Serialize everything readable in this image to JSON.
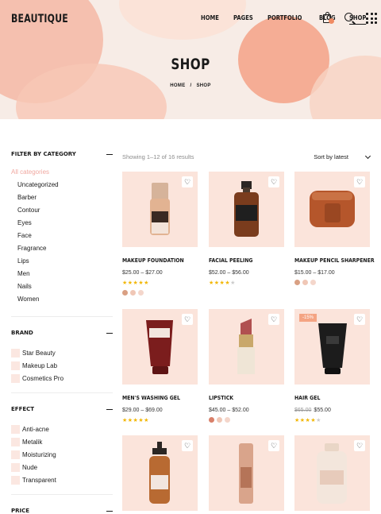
{
  "header": {
    "logo": "BEAUTIQUE",
    "nav": [
      {
        "label": "HOME",
        "active": false
      },
      {
        "label": "PAGES",
        "active": false
      },
      {
        "label": "PORTFOLIO",
        "active": false
      },
      {
        "label": "BLOG",
        "active": false
      },
      {
        "label": "SHOP",
        "active": true
      }
    ],
    "icons": [
      "cart-icon",
      "search-icon",
      "grid-menu-icon"
    ]
  },
  "hero": {
    "title": "SHOP",
    "breadcrumb": {
      "home": "HOME",
      "sep": "/",
      "current": "SHOP"
    }
  },
  "sidebar": {
    "category": {
      "title": "FILTER BY CATEGORY",
      "items": [
        "All categories",
        "Uncategorized",
        "Barber",
        "Contour",
        "Eyes",
        "Face",
        "Fragrance",
        "Lips",
        "Men",
        "Nails",
        "Women"
      ]
    },
    "brand": {
      "title": "BRAND",
      "items": [
        "Star Beauty",
        "Makeup Lab",
        "Cosmetics Pro"
      ]
    },
    "effect": {
      "title": "EFFECT",
      "items": [
        "Anti-acne",
        "Metalik",
        "Moisturizing",
        "Nude",
        "Transparent"
      ]
    },
    "price": {
      "title": "PRICE"
    }
  },
  "toolbar": {
    "result_count": "Showing 1–12 of 16 results",
    "sort_label": "Sort by latest"
  },
  "products": [
    {
      "name": "MAKEUP FOUNDATION",
      "price": "$25.00 – $27.00",
      "rating": 5,
      "swatches": [
        "#d9a083",
        "#f0c7b6",
        "#f4d6cb"
      ]
    },
    {
      "name": "FACIAL PEELING",
      "price": "$52.00 – $56.00",
      "rating": 4,
      "swatches": []
    },
    {
      "name": "MAKEUP PENCIL SHARPENER",
      "price": "$15.00 – $17.00",
      "rating": 0,
      "swatches": [
        "#d9a083",
        "#f0c7b6",
        "#f4d6cb"
      ]
    },
    {
      "name": "MEN'S WASHING GEL",
      "price": "$29.00 – $69.00",
      "rating": 5,
      "swatches": []
    },
    {
      "name": "LIPSTICK",
      "price": "$45.00 – $52.00",
      "rating": 0,
      "swatches": [
        "#d9806a",
        "#f0c7b6",
        "#f4d6cb"
      ]
    },
    {
      "name": "HAIR GEL",
      "old_price": "$65.00",
      "price": "$55.00",
      "badge": "-15%",
      "rating": 4,
      "swatches": []
    },
    {
      "name": "",
      "price": "",
      "rating": 0,
      "swatches": []
    },
    {
      "name": "",
      "price": "",
      "rating": 0,
      "swatches": []
    },
    {
      "name": "",
      "price": "",
      "rating": 0,
      "swatches": []
    }
  ],
  "colors": {
    "accent": "#f0a8a0",
    "thumb_bg": "#fbe4db",
    "star": "#f2b705",
    "badge": "#f4a483"
  }
}
